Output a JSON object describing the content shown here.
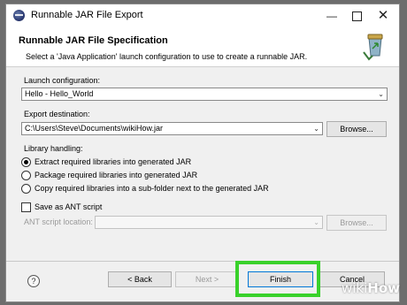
{
  "window": {
    "title": "Runnable JAR File Export",
    "controls": {
      "minimize": "—",
      "close": "✕"
    }
  },
  "header": {
    "title": "Runnable JAR File Specification",
    "description": "Select a 'Java Application' launch configuration to use to create a runnable JAR."
  },
  "launch": {
    "label": "Launch configuration:",
    "value": "Hello - Hello_World"
  },
  "export": {
    "label": "Export destination:",
    "value": "C:\\Users\\Steve\\Documents\\wikiHow.jar",
    "browse": "Browse..."
  },
  "library": {
    "label": "Library handling:",
    "options": [
      {
        "label": "Extract required libraries into generated JAR",
        "selected": true
      },
      {
        "label": "Package required libraries into generated JAR",
        "selected": false
      },
      {
        "label": "Copy required libraries into a sub-folder next to the generated JAR",
        "selected": false
      }
    ]
  },
  "ant": {
    "checkbox_label": "Save as ANT script",
    "checked": false,
    "location_label": "ANT script location:",
    "location_value": "",
    "browse": "Browse..."
  },
  "footer": {
    "help": "?",
    "back": "< Back",
    "next": "Next >",
    "finish": "Finish",
    "cancel": "Cancel",
    "highlight_color": "#39d12b"
  },
  "watermark": {
    "wiki": "wiki",
    "how": "How"
  }
}
